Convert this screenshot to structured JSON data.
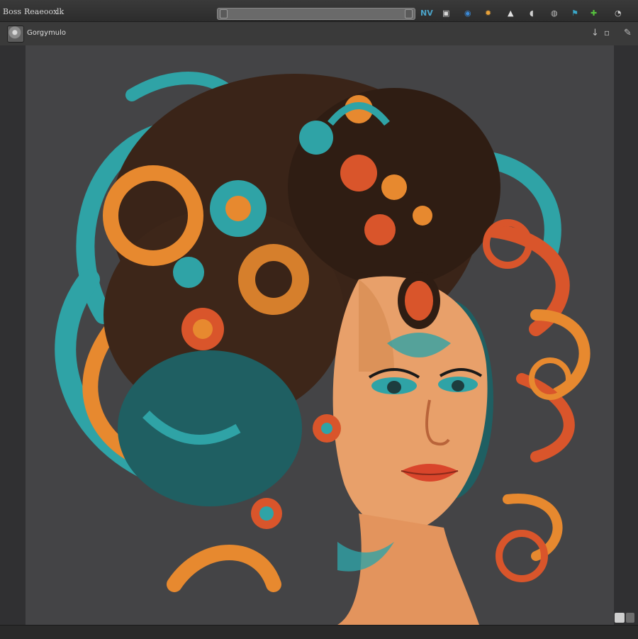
{
  "menu": {
    "items": [
      "Boss",
      "Reaeoox",
      "lk"
    ]
  },
  "toolbar": {
    "icons": [
      {
        "name": "nv-icon",
        "glyph": "NV",
        "color": "#4aa3c8"
      },
      {
        "name": "camera-icon",
        "glyph": "▣",
        "color": "#d8d8d8"
      },
      {
        "name": "blue-app-icon",
        "glyph": "◉",
        "color": "#3b8ad8"
      },
      {
        "name": "orange-app-icon",
        "glyph": "✹",
        "color": "#e8a23a"
      },
      {
        "name": "mountain-icon",
        "glyph": "▲",
        "color": "#e0e0e0"
      },
      {
        "name": "chat-icon",
        "glyph": "◖",
        "color": "#d0d0d0"
      },
      {
        "name": "globe-icon",
        "glyph": "◍",
        "color": "#bcbcbc"
      },
      {
        "name": "flag-icon",
        "glyph": "⚑",
        "color": "#3aa7c9"
      },
      {
        "name": "green-app-icon",
        "glyph": "✚",
        "color": "#56c23e"
      },
      {
        "name": "clock-icon",
        "glyph": "◔",
        "color": "#cfcfcf"
      }
    ]
  },
  "header": {
    "doc_title": "Gorgymulo",
    "icons": [
      {
        "name": "down-arrow-icon",
        "glyph": "↓"
      },
      {
        "name": "window-icon",
        "glyph": "▫"
      },
      {
        "name": "close-icon",
        "glyph": "✕"
      },
      {
        "name": "pen-icon",
        "glyph": "✎"
      }
    ]
  },
  "colors": {
    "teal": "#2fa3a6",
    "orange": "#e7892f",
    "red_orange": "#d9552b",
    "dark_brown": "#3a2418",
    "skin": "#e8a06a",
    "canvas_bg": "#444446"
  }
}
